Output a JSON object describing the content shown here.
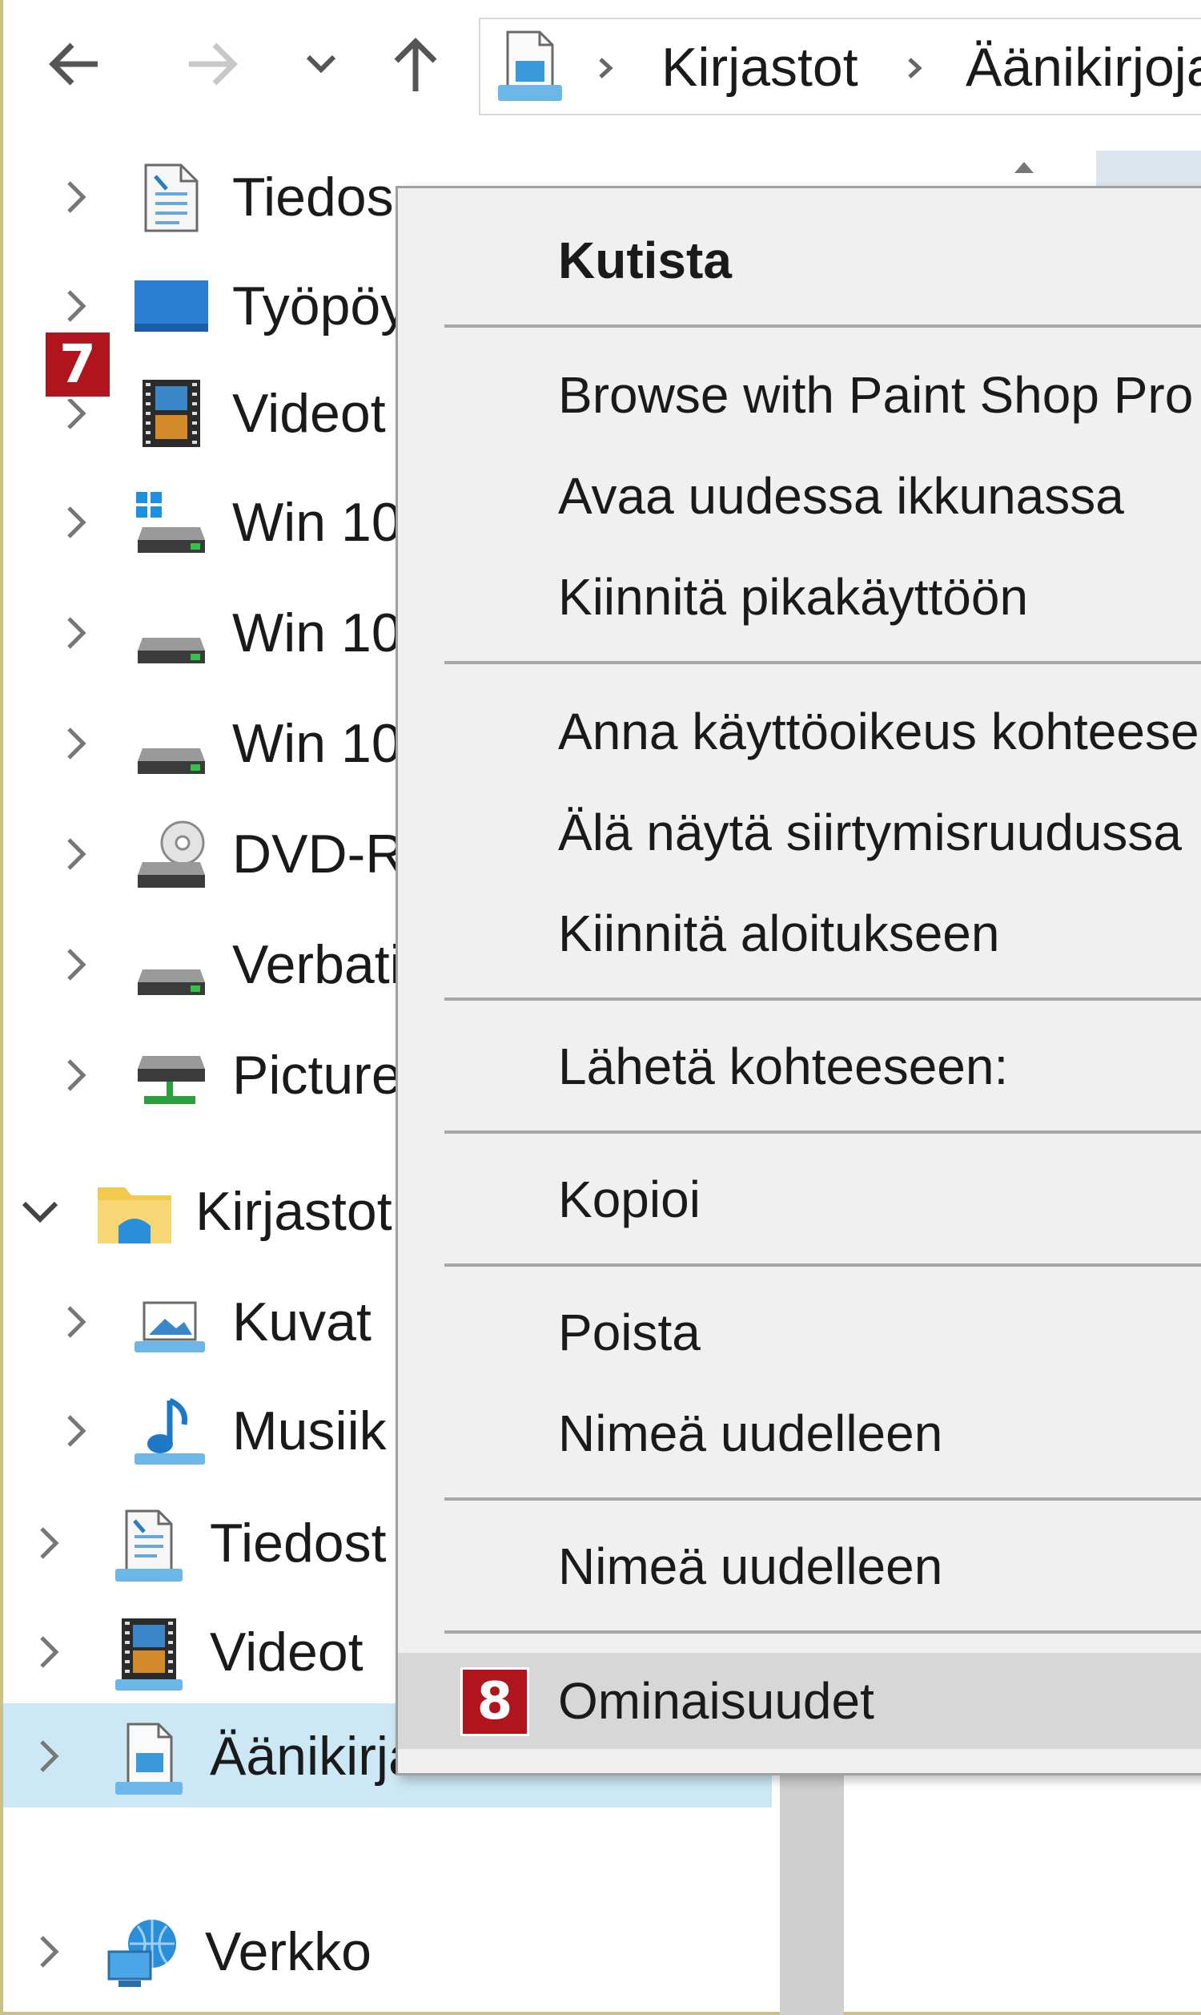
{
  "breadcrumb": {
    "items": [
      "Kirjastot",
      "Äänikirjoja"
    ]
  },
  "tree": {
    "items": [
      {
        "label": "Tiedos",
        "icon": "document-icon"
      },
      {
        "label": "Työpöy",
        "icon": "desktop-icon"
      },
      {
        "label": "Videot",
        "icon": "video-icon"
      },
      {
        "label": "Win 10",
        "icon": "windows-drive-icon"
      },
      {
        "label": "Win 10",
        "icon": "drive-icon"
      },
      {
        "label": "Win 10",
        "icon": "drive-icon"
      },
      {
        "label": "DVD-R",
        "icon": "dvd-drive-icon"
      },
      {
        "label": "Verbati",
        "icon": "drive-icon"
      },
      {
        "label": "Picture",
        "icon": "network-drive-icon"
      },
      {
        "label": "Kirjastot",
        "icon": "libraries-icon"
      },
      {
        "label": "Kuvat",
        "icon": "pictures-icon"
      },
      {
        "label": "Musiik",
        "icon": "music-icon"
      },
      {
        "label": "Tiedost",
        "icon": "document-icon"
      },
      {
        "label": "Videot",
        "icon": "video-icon"
      },
      {
        "label": "Äänikirjat",
        "icon": "audiobook-library-icon"
      },
      {
        "label": "Verkko",
        "icon": "network-icon"
      }
    ],
    "selected": "Äänikirjat"
  },
  "context_menu": {
    "items": [
      {
        "label": "Kutista",
        "bold": true
      },
      {
        "label": "Browse with Paint Shop Pro"
      },
      {
        "label": "Avaa uudessa ikkunassa"
      },
      {
        "label": "Kiinnitä pikakäyttöön"
      },
      {
        "label": "Anna käyttöoikeus kohteeseen"
      },
      {
        "label": "Älä näytä siirtymisruudussa"
      },
      {
        "label": "Kiinnitä aloitukseen"
      },
      {
        "label": "Lähetä kohteeseen:"
      },
      {
        "label": "Kopioi"
      },
      {
        "label": "Poista"
      },
      {
        "label": "Nimeä uudelleen"
      },
      {
        "label": "Nimeä uudelleen"
      },
      {
        "label": "Ominaisuudet"
      }
    ],
    "highlighted": "Ominaisuudet"
  },
  "badges": {
    "first": "7",
    "second": "8"
  },
  "colors": {
    "badge": "#b0141c",
    "selection": "#cce8f4",
    "menu_background": "#f0f0f0",
    "menu_highlight": "#d7d7d7"
  }
}
